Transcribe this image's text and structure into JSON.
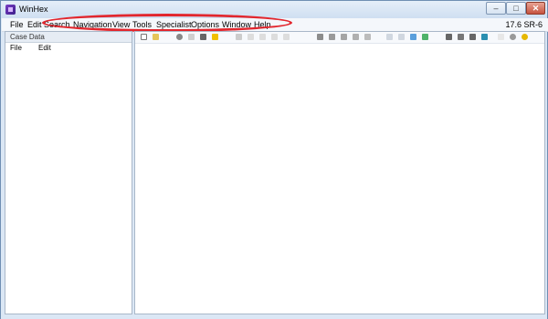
{
  "window": {
    "title": "WinHex"
  },
  "window_controls": {
    "minimize": "–",
    "maximize": "□",
    "close": "✕"
  },
  "menubar": {
    "items": [
      "File",
      "Edit",
      "Search",
      "Navigation",
      "View",
      "Tools",
      "Specialist",
      "Options",
      "Window",
      "Help"
    ],
    "version": "17.6 SR-6"
  },
  "case_data": {
    "title": "Case Data",
    "menu": [
      "File",
      "Edit"
    ]
  },
  "toolbar": {
    "icons": [
      "new-file-icon",
      "open-file-icon",
      "open-disk-icon",
      "save-icon",
      "print-icon",
      "properties-icon",
      "undo-icon",
      "cut-icon",
      "copy-icon",
      "paste-icon",
      "paste-special-icon",
      "find-text-icon",
      "find-hex-icon",
      "replace-text-icon",
      "replace-hex-icon",
      "goto-offset-icon",
      "back-icon",
      "forward-icon",
      "previous-icon",
      "next-icon",
      "disk-tools-icon",
      "ram-icon",
      "drive-icon",
      "calculator-icon",
      "script-icon",
      "web-icon",
      "help-icon"
    ]
  },
  "colors": {
    "annotation_oval": "#e2262d",
    "titlebar": "#dbe7f5"
  }
}
